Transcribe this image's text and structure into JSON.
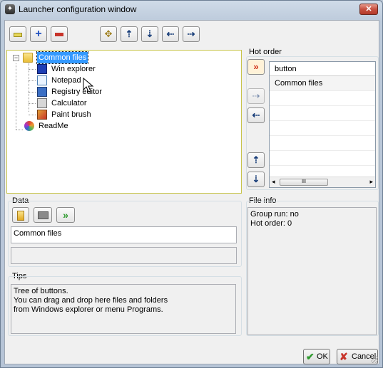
{
  "window": {
    "title": "Launcher configuration window",
    "close_label": "✕"
  },
  "toolbar": {
    "items": [
      {
        "name": "collapse-button",
        "icon": "minus-yellow-icon",
        "glyph": "▬"
      },
      {
        "name": "add-button",
        "icon": "plus-icon",
        "glyph": "✚"
      },
      {
        "name": "remove-button",
        "icon": "minus-icon",
        "glyph": "▬"
      },
      {
        "name": "move-target-button",
        "icon": "target-icon",
        "glyph": "✥"
      },
      {
        "name": "move-up-button",
        "icon": "arrow-up-icon",
        "glyph": "⇡"
      },
      {
        "name": "move-down-button",
        "icon": "arrow-down-icon",
        "glyph": "⇣"
      },
      {
        "name": "move-left-button",
        "icon": "arrow-left-icon",
        "glyph": "⇠"
      },
      {
        "name": "move-right-button",
        "icon": "arrow-right-icon",
        "glyph": "⇢"
      }
    ]
  },
  "tree": {
    "root": {
      "label": "Common files",
      "expander": "−",
      "icon": "folder-icon"
    },
    "children": [
      {
        "label": "Win explorer",
        "icon": "explorer-icon"
      },
      {
        "label": "Notepad",
        "icon": "notepad-icon"
      },
      {
        "label": "Registry editor",
        "icon": "registry-icon"
      },
      {
        "label": "Calculator",
        "icon": "calculator-icon"
      },
      {
        "label": "Paint brush",
        "icon": "paintbrush-icon"
      }
    ],
    "sibling": {
      "label": "ReadMe",
      "icon": "readme-icon"
    }
  },
  "hot_order": {
    "title": "Hot order",
    "column_header": "button",
    "rows": [
      "Common files"
    ],
    "scroll_glyph": "III"
  },
  "data_panel": {
    "title": "Data",
    "value": "Common files",
    "buttons": [
      {
        "name": "open-folder-button",
        "icon": "folder-open-icon"
      },
      {
        "name": "browse-folder-button",
        "icon": "folder-icon"
      },
      {
        "name": "run-button",
        "icon": "run-arrows-icon"
      }
    ]
  },
  "tips": {
    "title": "Tips",
    "text": "Tree of buttons.\n You can drag and drop here files and folders\n from Windows explorer or menu Programs."
  },
  "file_info": {
    "title": "File info",
    "group_run": "Group run: no",
    "hot_order": "Hot order: 0"
  },
  "footer": {
    "ok_label": "OK",
    "cancel_label": "Cancel"
  },
  "colors": {
    "accent": "#3399ff",
    "ok_green": "#2e9a2e",
    "cancel_red": "#c8342a",
    "add_blue": "#1f4fbf"
  }
}
